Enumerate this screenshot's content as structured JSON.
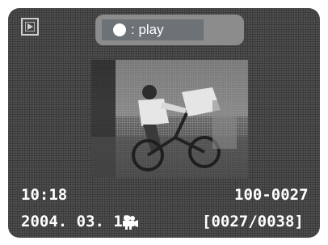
{
  "playback": {
    "mode_icon": "playback-mode-icon",
    "hint": {
      "button_icon": "center-button-icon",
      "label": ": play"
    },
    "thumbnail": "movie-thumbnail-cyclist",
    "time": "10:18",
    "file_number": "100-0027",
    "date": "2004. 03. 13",
    "movie_icon": "movie-camera-icon",
    "frame_counter": "[0027/0038]"
  },
  "colors": {
    "background": "#3b3b3b",
    "pill": "#8c8c8c",
    "pill_inner": "#6d7277",
    "text": "#ffffff"
  }
}
